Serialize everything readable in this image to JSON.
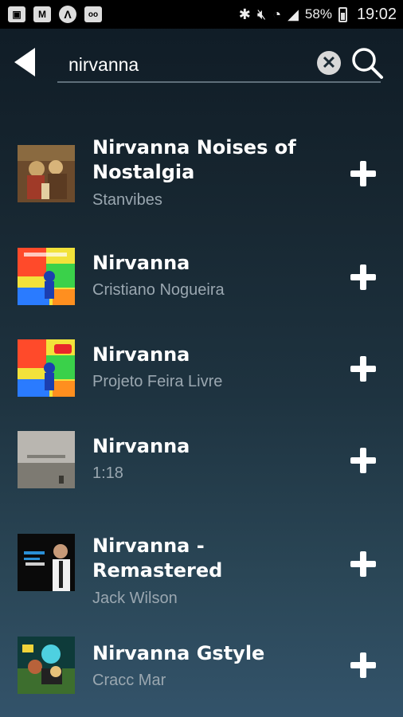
{
  "status": {
    "battery": "58%",
    "time": "19:02"
  },
  "search": {
    "value": "nirvanna",
    "clear_symbol": "✕"
  },
  "results": [
    {
      "title_line1": "Nirvanna Noises of",
      "title_line2": "Nostalgia",
      "artist": "Stanvibes",
      "thumb": "album-art-painting"
    },
    {
      "title_line1": "Nirvanna",
      "title_line2": "",
      "artist": "Cristiano Nogueira",
      "thumb": "album-art-colorful"
    },
    {
      "title_line1": "Nirvanna",
      "title_line2": "",
      "artist": "Projeto Feira Livre",
      "thumb": "album-art-colorful"
    },
    {
      "title_line1": "Nirvanna",
      "title_line2": "",
      "artist": "1:18",
      "thumb": "album-art-landscape"
    },
    {
      "title_line1": "Nirvanna -",
      "title_line2": "Remastered",
      "artist": "Jack Wilson",
      "thumb": "album-art-portrait"
    },
    {
      "title_line1": "Nirvanna Gstyle",
      "title_line2": "",
      "artist": "Cracc Mar",
      "thumb": "album-art-cartoon"
    }
  ]
}
